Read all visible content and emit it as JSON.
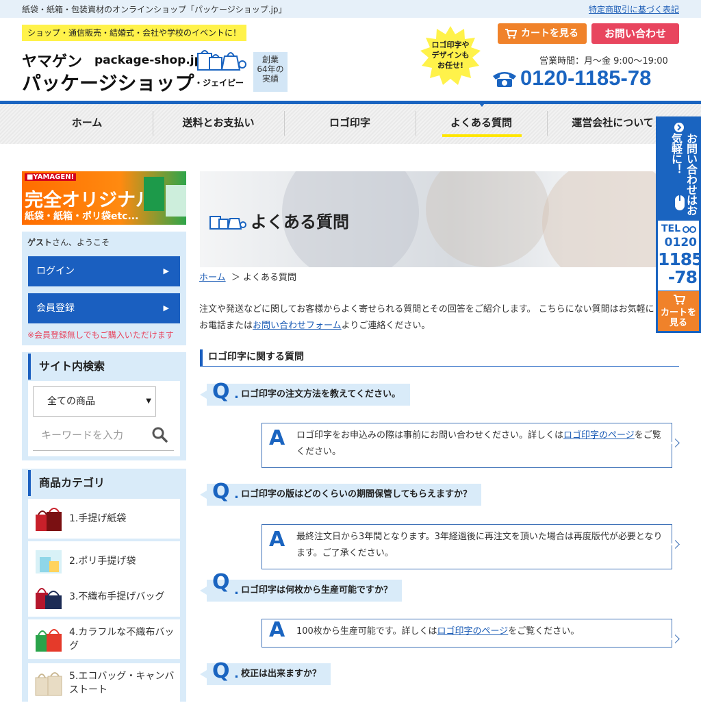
{
  "topbar": {
    "tagline": "紙袋・紙箱・包装資材のオンラインショップ「パッケージショップ.jp」",
    "law_link": "特定商取引に基づく表記"
  },
  "header": {
    "catch": "ショップ・通信販売・結婚式・会社や学校のイベントに！",
    "logo_brand": "ヤマゲン",
    "logo_domain": "package-shop.jp",
    "logo_name": "パッケージショップ",
    "logo_suffix": "・ジェイピー",
    "anniversary": "創業\n64年の\n実績",
    "burst": "ロゴ印字や\nデザインも\nお任せ!",
    "cart_button": "カートを見る",
    "contact_button": "お問い合わせ",
    "hours": "営業時間：月〜金 9:00〜19:00",
    "phone": "0120-1185-78"
  },
  "nav": [
    {
      "label": "ホーム",
      "active": false
    },
    {
      "label": "送料とお支払い",
      "active": false
    },
    {
      "label": "ロゴ印字",
      "active": false
    },
    {
      "label": "よくある質問",
      "active": true
    },
    {
      "label": "運営会社について",
      "active": false
    }
  ],
  "sidebar": {
    "banner": {
      "brand": "■YAMAGEN!",
      "title": "完全オリジナル",
      "sub": "紙袋・紙箱・ポリ袋etc..."
    },
    "welcome_name": "ゲスト",
    "welcome_suffix": "さん、ようこそ",
    "login": "ログイン",
    "register": "会員登録",
    "arrow": "▶",
    "note": "※会員登録無しでもご購入いただけます",
    "search": {
      "title": "サイト内検索",
      "select_value": "全ての商品",
      "select_caret": "▼",
      "placeholder": "キーワードを入力"
    },
    "categories_title": "商品カテゴリ",
    "categories": [
      {
        "label": "1.手提げ紙袋",
        "color1": "#c8202a",
        "color2": "#7a1012"
      },
      {
        "label": "2.ポリ手提げ袋",
        "color1": "#8fd6e8",
        "color2": "#d8f1f7"
      },
      {
        "label": "3.不織布手提げバッグ",
        "color1": "#1c2b55",
        "color2": "#b5162c"
      },
      {
        "label": "4.カラフルな不織布バッグ",
        "color1": "#2aa34a",
        "color2": "#e53a2a"
      },
      {
        "label": "5.エコバッグ・キャンバストート",
        "color1": "#e8dcc4",
        "color2": "#cbb994"
      }
    ]
  },
  "main": {
    "hero_title": "よくある質問",
    "breadcrumb_home": "ホーム",
    "breadcrumb_sep": "＞",
    "breadcrumb_current": "よくある質問",
    "intro_before": "注文や発送などに関してお客様からよく寄せられる質問とその回答をご紹介します。 こちらにない質問はお気軽にお電話または",
    "intro_link": "お問い合わせフォーム",
    "intro_after": "よりご連絡ください。",
    "section_title": "ロゴ印字に関する質問",
    "q_mark": "Q",
    "a_mark": "A",
    "faqs": [
      {
        "q": "ロゴ印字の注文方法を教えてください。",
        "a_before": "ロゴ印字をお申込みの際は事前にお問い合わせください。詳しくは",
        "a_link": "ロゴ印字のページ",
        "a_after": "をご覧ください。"
      },
      {
        "q": "ロゴ印字の版はどのくらいの期間保管してもらえますか？",
        "a_before": "最終注文日から3年間となります。3年経過後に再注文を頂いた場合は再度版代が必要となります。ご了承ください。",
        "a_link": "",
        "a_after": ""
      },
      {
        "q": "ロゴ印字は何枚から生産可能ですか？",
        "a_before": "100枚から生産可能です。詳しくは",
        "a_link": "ロゴ印字のページ",
        "a_after": "をご覧ください。"
      },
      {
        "q": "校正は出来ますか？"
      }
    ]
  },
  "float_tab": {
    "contact": "お問い合わせはお気軽に！",
    "tel_label": "TEL",
    "tel_1": "0120",
    "tel_2": "1185",
    "tel_3": "-78",
    "cart": "カートを\n見る"
  },
  "colors": {
    "brand_blue": "#1a64c0",
    "light_blue": "#d9ebf9",
    "orange": "#f0822a",
    "pink": "#e8455e",
    "yellow": "#ffe600"
  }
}
